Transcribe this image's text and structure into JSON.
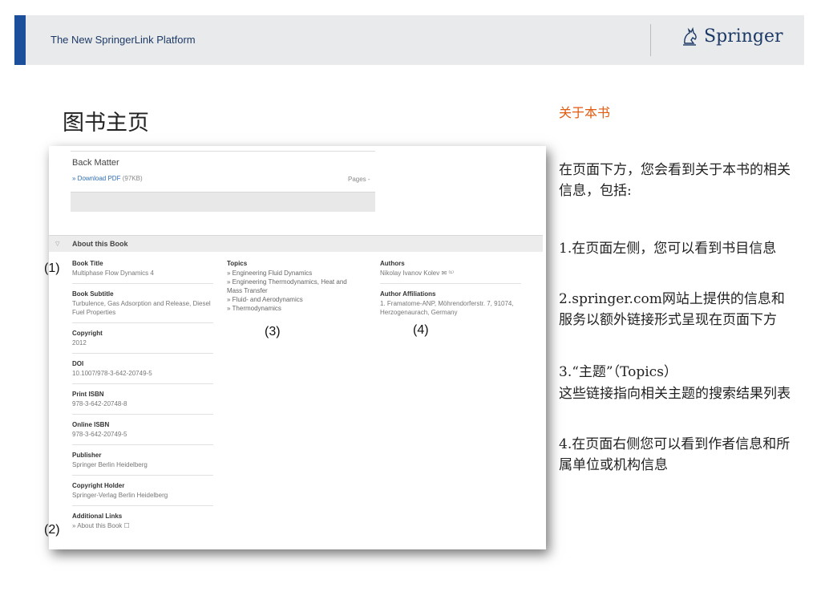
{
  "header": {
    "title": "The New SpringerLink Platform",
    "brand": "Springer",
    "accent_color": "#1b4f9c"
  },
  "slide": {
    "title": "图书主页"
  },
  "screenshot": {
    "back_matter": "Back Matter",
    "download": "» Download PDF",
    "download_size": "(97KB)",
    "pages": "Pages -",
    "about_label": "About this Book",
    "fields": [
      {
        "label": "Book Title",
        "value": "Multiphase Flow Dynamics 4"
      },
      {
        "label": "Book Subtitle",
        "value": "Turbulence, Gas Adsorption and Release, Diesel Fuel Properties"
      },
      {
        "label": "Copyright",
        "value": "2012"
      },
      {
        "label": "DOI",
        "value": "10.1007/978-3-642-20749-5"
      },
      {
        "label": "Print ISBN",
        "value": "978-3-642-20748-8"
      },
      {
        "label": "Online ISBN",
        "value": "978-3-642-20749-5"
      },
      {
        "label": "Publisher",
        "value": "Springer Berlin Heidelberg"
      },
      {
        "label": "Copyright Holder",
        "value": "Springer-Verlag Berlin Heidelberg"
      },
      {
        "label": "Additional Links",
        "value": "» About this Book ☐"
      }
    ],
    "topics_label": "Topics",
    "topics": [
      "» Engineering Fluid Dynamics",
      "» Engineering Thermodynamics, Heat and Mass Transfer",
      "» Fluid- and Aerodynamics",
      "» Thermodynamics"
    ],
    "authors_label": "Authors",
    "author": "Nikolay Ivanov Kolev ✉ ⁽¹⁾",
    "affiliations_label": "Author Affiliations",
    "affiliation": "1. Framatome-ANP, Möhrendorferstr. 7, 91074, Herzogenaurach, Germany",
    "refs": [
      "(1)",
      "(2)",
      "(3)",
      "(4)"
    ]
  },
  "right": {
    "heading": "关于本书",
    "intro": "在页面下方，您会看到关于本书的相关信息，包括:",
    "items": [
      "1.在页面左侧，您可以看到书目信息",
      "2.springer.com网站上提供的信息和服务以额外链接形式呈现在页面下方",
      "3.“主题”（Topics）",
      "这些链接指向相关主题的搜索结果列表",
      "4.在页面右侧您可以看到作者信息和所属单位或机构信息"
    ],
    "heading_color": "#e05a10"
  }
}
